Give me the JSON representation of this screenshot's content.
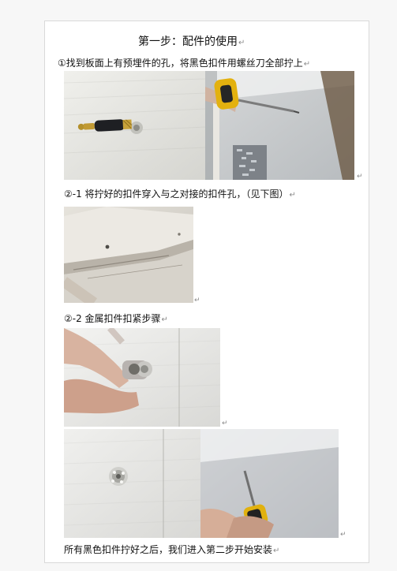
{
  "document": {
    "step_title": "第一步：配件的使用",
    "intro_line": "①找到板面上有预埋件的孔，将黑色扣件用螺丝刀全部拧上",
    "section_2_1": "②-1 将拧好的扣件穿入与之对接的扣件孔，（见下图）",
    "section_2_2": "②-2  金属扣件扣紧步骤",
    "closing_line": "所有黑色扣件拧好之后，我们进入第二步开始安装"
  },
  "ui": {
    "paragraph_mark": "↵"
  },
  "colors": {
    "page_bg": "#ffffff",
    "outer_bg": "#f7f7f7",
    "mark_gray": "#8a8a8a",
    "photo_gray": "#d8d8d8"
  }
}
